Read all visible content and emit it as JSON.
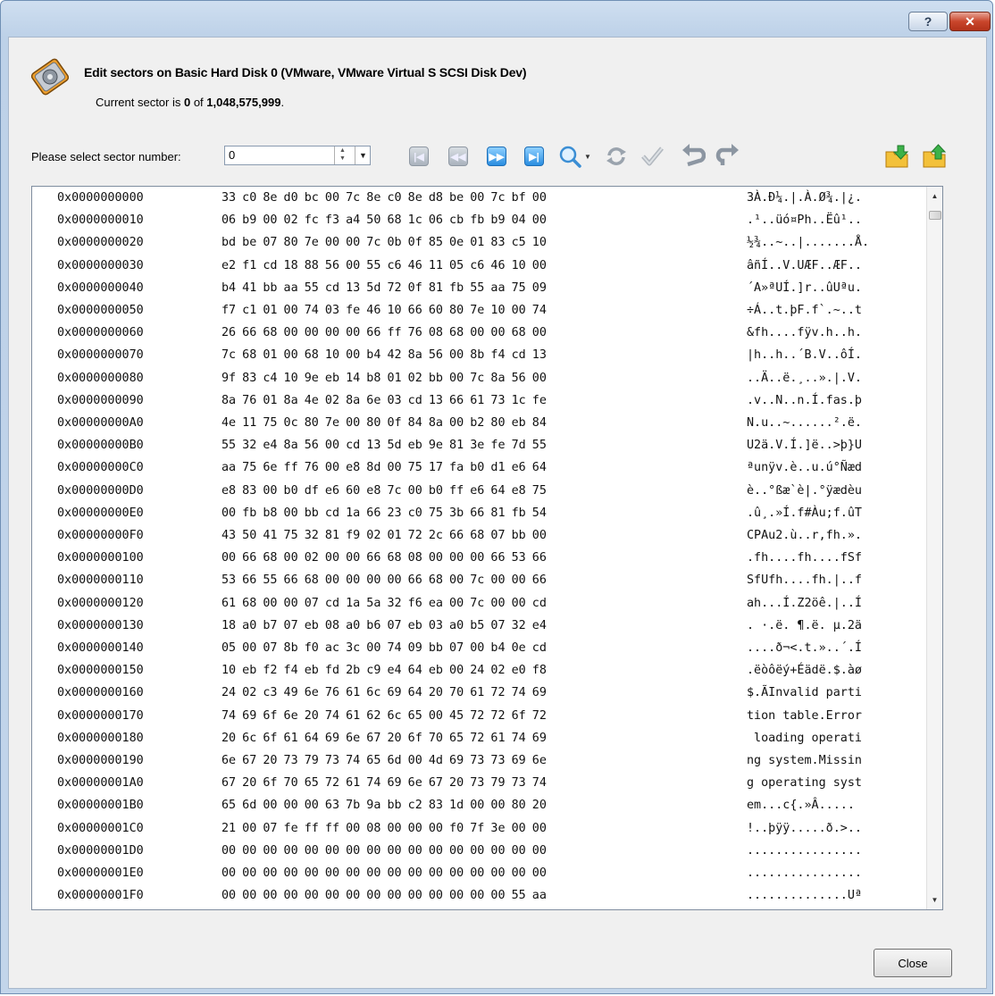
{
  "window": {
    "help_label": "?",
    "close_glyph": "✕"
  },
  "header": {
    "title": "Edit sectors on Basic Hard Disk 0 (VMware, VMware Virtual S SCSI Disk Dev)",
    "current_prefix": "Current sector is ",
    "current_sector": "0",
    "of_text": " of ",
    "total_sectors": "1,048,575,999",
    "period": "."
  },
  "toolbar": {
    "select_label": "Please select sector number:",
    "sector_value": "0",
    "icons": [
      "first-sector-icon",
      "previous-sector-icon",
      "next-sector-icon",
      "last-sector-icon",
      "search-icon",
      "search-dropdown-icon",
      "revert-icon",
      "apply-icon",
      "undo-icon",
      "redo-icon",
      "export-icon",
      "import-icon"
    ]
  },
  "hex": {
    "rows": [
      {
        "addr": "0x0000000000",
        "bytes": "33 c0 8e d0 bc 00 7c 8e c0 8e d8 be 00 7c bf 00",
        "ascii": "3À.Ð¼.|.À.Ø¾.|¿."
      },
      {
        "addr": "0x0000000010",
        "bytes": "06 b9 00 02 fc f3 a4 50 68 1c 06 cb fb b9 04 00",
        "ascii": ".¹..üó¤Ph..Ëû¹.."
      },
      {
        "addr": "0x0000000020",
        "bytes": "bd be 07 80 7e 00 00 7c 0b 0f 85 0e 01 83 c5 10",
        "ascii": "½¾..~..|.......Å."
      },
      {
        "addr": "0x0000000030",
        "bytes": "e2 f1 cd 18 88 56 00 55 c6 46 11 05 c6 46 10 00",
        "ascii": "âñÍ..V.UÆF..ÆF.."
      },
      {
        "addr": "0x0000000040",
        "bytes": "b4 41 bb aa 55 cd 13 5d 72 0f 81 fb 55 aa 75 09",
        "ascii": "´A»ªUÍ.]r..ûUªu."
      },
      {
        "addr": "0x0000000050",
        "bytes": "f7 c1 01 00 74 03 fe 46 10 66 60 80 7e 10 00 74",
        "ascii": "÷Á..t.þF.f`.~..t"
      },
      {
        "addr": "0x0000000060",
        "bytes": "26 66 68 00 00 00 00 66 ff 76 08 68 00 00 68 00",
        "ascii": "&fh....fÿv.h..h."
      },
      {
        "addr": "0x0000000070",
        "bytes": "7c 68 01 00 68 10 00 b4 42 8a 56 00 8b f4 cd 13",
        "ascii": "|h..h..´B.V..ôÍ."
      },
      {
        "addr": "0x0000000080",
        "bytes": "9f 83 c4 10 9e eb 14 b8 01 02 bb 00 7c 8a 56 00",
        "ascii": "..Ä..ë.¸..».|.V."
      },
      {
        "addr": "0x0000000090",
        "bytes": "8a 76 01 8a 4e 02 8a 6e 03 cd 13 66 61 73 1c fe",
        "ascii": ".v..N..n.Í.fas.þ"
      },
      {
        "addr": "0x00000000A0",
        "bytes": "4e 11 75 0c 80 7e 00 80 0f 84 8a 00 b2 80 eb 84",
        "ascii": "N.u..~......².ë."
      },
      {
        "addr": "0x00000000B0",
        "bytes": "55 32 e4 8a 56 00 cd 13 5d eb 9e 81 3e fe 7d 55",
        "ascii": "U2ä.V.Í.]ë..>þ}U"
      },
      {
        "addr": "0x00000000C0",
        "bytes": "aa 75 6e ff 76 00 e8 8d 00 75 17 fa b0 d1 e6 64",
        "ascii": "ªunÿv.è..u.ú°Ñæd"
      },
      {
        "addr": "0x00000000D0",
        "bytes": "e8 83 00 b0 df e6 60 e8 7c 00 b0 ff e6 64 e8 75",
        "ascii": "è..°ßæ`è|.°ÿædèu"
      },
      {
        "addr": "0x00000000E0",
        "bytes": "00 fb b8 00 bb cd 1a 66 23 c0 75 3b 66 81 fb 54",
        "ascii": ".û¸.»Í.f#Àu;f.ûT"
      },
      {
        "addr": "0x00000000F0",
        "bytes": "43 50 41 75 32 81 f9 02 01 72 2c 66 68 07 bb 00",
        "ascii": "CPAu2.ù..r,fh.»."
      },
      {
        "addr": "0x0000000100",
        "bytes": "00 66 68 00 02 00 00 66 68 08 00 00 00 66 53 66",
        "ascii": ".fh....fh....fSf"
      },
      {
        "addr": "0x0000000110",
        "bytes": "53 66 55 66 68 00 00 00 00 66 68 00 7c 00 00 66",
        "ascii": "SfUfh....fh.|..f"
      },
      {
        "addr": "0x0000000120",
        "bytes": "61 68 00 00 07 cd 1a 5a 32 f6 ea 00 7c 00 00 cd",
        "ascii": "ah...Í.Z2öê.|..Í"
      },
      {
        "addr": "0x0000000130",
        "bytes": "18 a0 b7 07 eb 08 a0 b6 07 eb 03 a0 b5 07 32 e4",
        "ascii": ". ·.ë. ¶.ë. µ.2ä"
      },
      {
        "addr": "0x0000000140",
        "bytes": "05 00 07 8b f0 ac 3c 00 74 09 bb 07 00 b4 0e cd",
        "ascii": "....ð¬<.t.»..´.Í"
      },
      {
        "addr": "0x0000000150",
        "bytes": "10 eb f2 f4 eb fd 2b c9 e4 64 eb 00 24 02 e0 f8",
        "ascii": ".ëòôëý+Éädë.$.àø"
      },
      {
        "addr": "0x0000000160",
        "bytes": "24 02 c3 49 6e 76 61 6c 69 64 20 70 61 72 74 69",
        "ascii": "$.ÃInvalid parti"
      },
      {
        "addr": "0x0000000170",
        "bytes": "74 69 6f 6e 20 74 61 62 6c 65 00 45 72 72 6f 72",
        "ascii": "tion table.Error"
      },
      {
        "addr": "0x0000000180",
        "bytes": "20 6c 6f 61 64 69 6e 67 20 6f 70 65 72 61 74 69",
        "ascii": " loading operati"
      },
      {
        "addr": "0x0000000190",
        "bytes": "6e 67 20 73 79 73 74 65 6d 00 4d 69 73 73 69 6e",
        "ascii": "ng system.Missin"
      },
      {
        "addr": "0x00000001A0",
        "bytes": "67 20 6f 70 65 72 61 74 69 6e 67 20 73 79 73 74",
        "ascii": "g operating syst"
      },
      {
        "addr": "0x00000001B0",
        "bytes": "65 6d 00 00 00 63 7b 9a bb c2 83 1d 00 00 80 20",
        "ascii": "em...c{.»Â..... "
      },
      {
        "addr": "0x00000001C0",
        "bytes": "21 00 07 fe ff ff 00 08 00 00 00 f0 7f 3e 00 00",
        "ascii": "!..þÿÿ.....ð.>.."
      },
      {
        "addr": "0x00000001D0",
        "bytes": "00 00 00 00 00 00 00 00 00 00 00 00 00 00 00 00",
        "ascii": "................"
      },
      {
        "addr": "0x00000001E0",
        "bytes": "00 00 00 00 00 00 00 00 00 00 00 00 00 00 00 00",
        "ascii": "................"
      },
      {
        "addr": "0x00000001F0",
        "bytes": "00 00 00 00 00 00 00 00 00 00 00 00 00 00 55 aa",
        "ascii": "..............Uª"
      }
    ]
  },
  "footer": {
    "close_label": "Close"
  }
}
